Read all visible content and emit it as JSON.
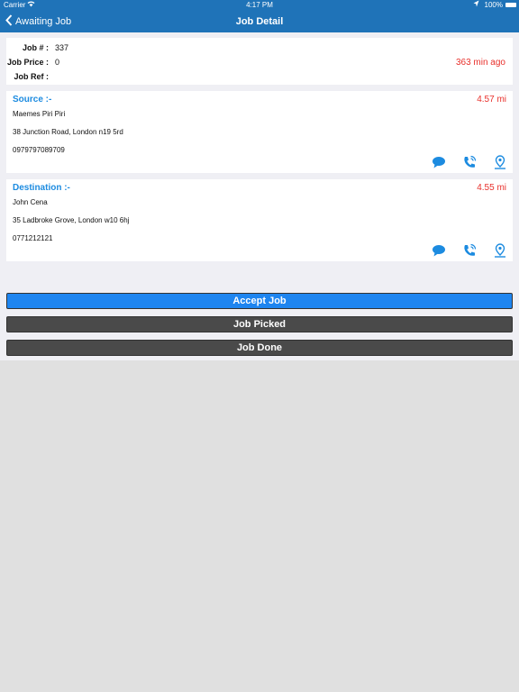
{
  "status_bar": {
    "carrier": "Carrier",
    "time": "4:17 PM",
    "battery": "100%"
  },
  "nav": {
    "back_label": "Awaiting Job",
    "title": "Job Detail"
  },
  "job": {
    "number_label": "Job # :",
    "number": "337",
    "price_label": "Job Price :",
    "price": "0",
    "ref_label": "Job Ref :",
    "ref": "",
    "time_ago": "363 min ago"
  },
  "source": {
    "heading": "Source :-",
    "distance": "4.57 mi",
    "name": "Maemes Piri Piri",
    "address": "38 Junction Road, London n19 5rd",
    "phone": "0979797089709"
  },
  "destination": {
    "heading": "Destination :-",
    "distance": "4.55 mi",
    "name": "John Cena",
    "address": "35 Ladbroke Grove, London w10 6hj",
    "phone": "0771212121"
  },
  "actions": {
    "accept": "Accept Job",
    "picked": "Job Picked",
    "done": "Job Done"
  },
  "colors": {
    "nav_bg": "#1f73b8",
    "accent_blue": "#1c8be0",
    "alert_red": "#e8302b",
    "accept_bg": "#1e85f0",
    "dark_button": "#4a4a4a"
  },
  "icons": [
    "wifi-icon",
    "location-arrow-icon",
    "battery-icon",
    "chevron-left-icon",
    "chat-icon",
    "phone-icon",
    "map-pin-icon"
  ]
}
